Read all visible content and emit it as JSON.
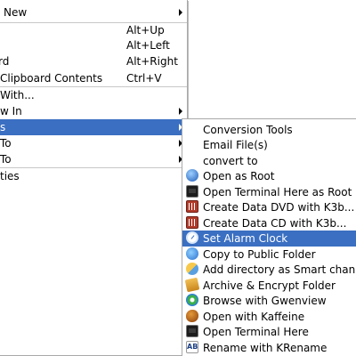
{
  "main_menu": {
    "items": [
      {
        "label": "New",
        "shortcut": ""
      },
      {
        "label": "",
        "shortcut": "Alt+Up"
      },
      {
        "label": "",
        "shortcut": "Alt+Left"
      },
      {
        "label": "rd",
        "shortcut": "Alt+Right"
      },
      {
        "label": "Clipboard Contents",
        "shortcut": "Ctrl+V"
      },
      {
        "label": "With...",
        "shortcut": ""
      },
      {
        "label": "w In",
        "shortcut": ""
      },
      {
        "label": "s",
        "shortcut": ""
      },
      {
        "label": "To",
        "shortcut": ""
      },
      {
        "label": "To",
        "shortcut": ""
      },
      {
        "label": "ties",
        "shortcut": ""
      }
    ]
  },
  "sub_menu": {
    "items": [
      {
        "label": "Conversion Tools",
        "icon": "none"
      },
      {
        "label": "Email File(s)",
        "icon": "none"
      },
      {
        "label": "convert to",
        "icon": "none"
      },
      {
        "label": "Open as Root",
        "icon": "root-icon"
      },
      {
        "label": "Open Terminal Here as Root",
        "icon": "terminal-icon"
      },
      {
        "label": "Create Data DVD with K3b...",
        "icon": "k3b-icon"
      },
      {
        "label": "Create Data CD with K3b...",
        "icon": "k3b-icon"
      },
      {
        "label": "Set Alarm Clock",
        "icon": "alarm-clock-icon"
      },
      {
        "label": "Copy to Public Folder",
        "icon": "public-folder-icon"
      },
      {
        "label": "Add directory as Smart channel",
        "icon": "smart-channel-icon"
      },
      {
        "label": "Archive & Encrypt Folder",
        "icon": "archive-icon"
      },
      {
        "label": "Browse with Gwenview",
        "icon": "gwenview-icon"
      },
      {
        "label": "Open with Kaffeine",
        "icon": "kaffeine-icon"
      },
      {
        "label": "Open Terminal Here",
        "icon": "terminal-icon"
      },
      {
        "label": "Rename with KRename",
        "icon": "krename-icon",
        "icon_text": "AB"
      }
    ]
  },
  "colors": {
    "highlight": "#3a6fc2",
    "highlight_text": "#ffffff"
  }
}
